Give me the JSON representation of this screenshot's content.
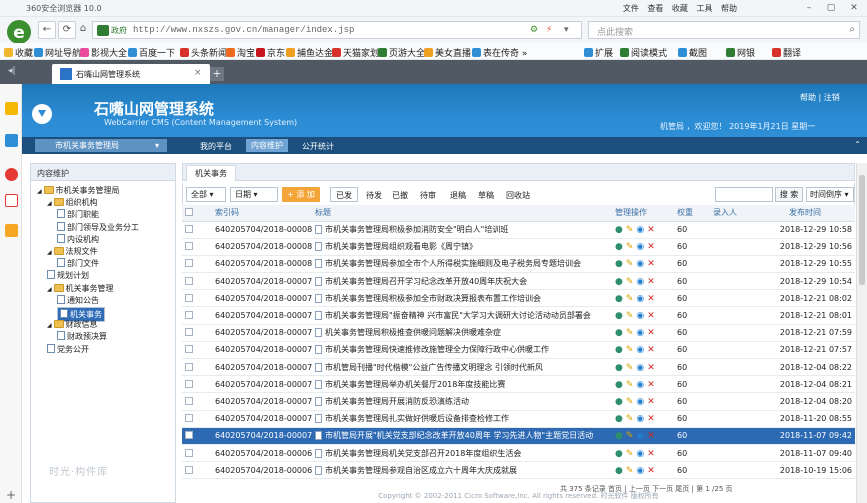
{
  "browser": {
    "title": "360安全浏览器 10.0",
    "menu": "文件 查看 收藏 工具 帮助",
    "url_badge": "政府",
    "url": "http://www.nxszs.gov.cn/manager/index.jsp",
    "search_placeholder": "点此搜索",
    "bookmarks": [
      "收藏",
      "网址导航",
      "影视大全",
      "百度一下",
      "头条新闻",
      "淘宝",
      "京东",
      "捕鱼达金",
      "天猫家划",
      "页游大全",
      "美女直播",
      "表在传奇 »"
    ],
    "bookmarks_right": [
      "扩展",
      "阅读模式",
      "截图",
      "网银",
      "翻译"
    ],
    "tab_title": "石嘴山网管理系统"
  },
  "cms": {
    "title": "石嘴山网管理系统",
    "subtitle": "WebCarrier CMS (Content Management System)",
    "top_links": "帮助 | 注销",
    "welcome": "机管局 ，欢迎您！ 2019年1月21日 星期一",
    "org_select": "市机关事务管理局",
    "nav": [
      "我的平台",
      "内容维护",
      "公开统计"
    ]
  },
  "sidebar": {
    "header": "内容维护",
    "tree": [
      {
        "label": "市机关事务管理局",
        "type": "folder",
        "level": 0
      },
      {
        "label": "组织机构",
        "type": "folder",
        "level": 1
      },
      {
        "label": "部门职能",
        "type": "doc",
        "level": 2
      },
      {
        "label": "部门领导及业务分工",
        "type": "doc",
        "level": 2
      },
      {
        "label": "内设机构",
        "type": "doc",
        "level": 2
      },
      {
        "label": "法规文件",
        "type": "folder",
        "level": 1
      },
      {
        "label": "部门文件",
        "type": "doc",
        "level": 2
      },
      {
        "label": "规划计划",
        "type": "doc",
        "level": 1
      },
      {
        "label": "机关事务管理",
        "type": "folder",
        "level": 1
      },
      {
        "label": "通知公告",
        "type": "doc",
        "level": 2
      },
      {
        "label": "机关事务",
        "type": "doc",
        "level": 2,
        "selected": true
      },
      {
        "label": "财政信息",
        "type": "folder",
        "level": 1
      },
      {
        "label": "财政预决算",
        "type": "doc",
        "level": 2
      },
      {
        "label": "党务公开",
        "type": "doc",
        "level": 1
      }
    ],
    "watermark": "时光·构件库"
  },
  "content": {
    "tab": "机关事务",
    "toolbar": {
      "all": "全部",
      "date": "日期",
      "add": "+ 添 加",
      "filters": [
        "已发",
        "待发",
        "已撤",
        "待审",
        "退稿",
        "草稿",
        "回收站"
      ],
      "search_btn": "搜 索",
      "sort": "时间倒序"
    },
    "columns": [
      "索引码",
      "标题",
      "管理操作",
      "权重",
      "录入人",
      "发布时间"
    ],
    "rows": [
      {
        "code": "640205704/2018-000082",
        "title": "市机关事务管理局积极参加消防安全\"明白人\"培训班",
        "weight": "60",
        "author": "",
        "time": "2018-12-29 10:58"
      },
      {
        "code": "640205704/2018-000081",
        "title": "市机关事务管理局组织观看电影《周宁镇》",
        "weight": "60",
        "author": "",
        "time": "2018-12-29 10:56"
      },
      {
        "code": "640205704/2018-000080",
        "title": "市机关事务管理局参加全市个人所得税实施细则及电子税务局专题培训会",
        "weight": "60",
        "author": "",
        "time": "2018-12-29 10:55"
      },
      {
        "code": "640205704/2018-000079",
        "title": "市机关事务管理局召开学习纪念改革开放40周年庆祝大会",
        "weight": "60",
        "author": "",
        "time": "2018-12-29 10:54"
      },
      {
        "code": "640205704/2018-000078",
        "title": "市机关事务管理局积极参加全市财政决算报表布置工作培训会",
        "weight": "60",
        "author": "",
        "time": "2018-12-21 08:02"
      },
      {
        "code": "640205704/2018-000077",
        "title": "市机关事务管理局\"振奋精神 兴市富民\"大学习大调研大讨论活动动员部署会",
        "weight": "60",
        "author": "",
        "time": "2018-12-21 08:01"
      },
      {
        "code": "640205704/2018-000076",
        "title": "机关事务管理局积极推查供暖问题解决供暖难杂症",
        "weight": "60",
        "author": "",
        "time": "2018-12-21 07:59"
      },
      {
        "code": "640205704/2018-000075",
        "title": "市机关事务管理局快速推修改施管理全力保障行政中心供暖工作",
        "weight": "60",
        "author": "",
        "time": "2018-12-21 07:57"
      },
      {
        "code": "640205704/2018-000074",
        "title": "市机管局刊播\"时代楷模\"公益广告传播文明理念 引领时代新风",
        "weight": "60",
        "author": "",
        "time": "2018-12-04 08:22"
      },
      {
        "code": "640205704/2018-000073",
        "title": "市机关事务管理局举办机关餐厅2018年度技能比赛",
        "weight": "60",
        "author": "",
        "time": "2018-12-04 08:21"
      },
      {
        "code": "640205704/2018-000072",
        "title": "市机关事务管理局开展消防反恐演练活动",
        "weight": "60",
        "author": "",
        "time": "2018-12-04 08:20"
      },
      {
        "code": "640205704/2018-000071",
        "title": "市机关事务管理局扎实做好供暖后设备排查检修工作",
        "weight": "60",
        "author": "",
        "time": "2018-11-20 08:55"
      },
      {
        "code": "640205704/2018-000070",
        "title": "市机管局开展\"机关党支部纪念改革开放40周年 学习先进人物\"主题党日活动",
        "weight": "60",
        "author": "",
        "time": "2018-11-07 09:42",
        "highlight": true
      },
      {
        "code": "640205704/2018-000069",
        "title": "市机关事务管理局机关党支部召开2018年度组织生活会",
        "weight": "60",
        "author": "",
        "time": "2018-11-07 09:40"
      },
      {
        "code": "640205704/2018-000068",
        "title": "市机关事务管理局参观自治区成立六十周年大庆成就展",
        "weight": "60",
        "author": "",
        "time": "2018-10-19 15:06"
      }
    ],
    "pager": "共 375 条记录 首页 | 上一页 下一页 尾页 | 第 1 /25 页",
    "footer": "Copyright © 2002-2011 Cicro Software,Inc. All rights reserved. 时光软件 版权所有"
  }
}
